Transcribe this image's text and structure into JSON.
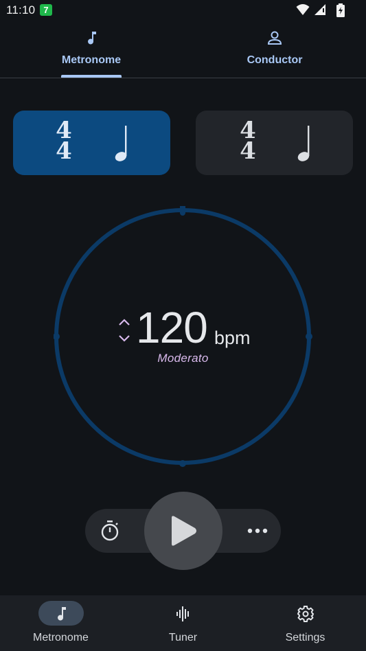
{
  "status_bar": {
    "time": "11:10",
    "notification_badge": "7",
    "icons": [
      "wifi-icon",
      "signal-icon",
      "battery-charging-icon"
    ]
  },
  "top_tabs": [
    {
      "label": "Metronome",
      "icon": "music-note-icon",
      "selected": true
    },
    {
      "label": "Conductor",
      "icon": "person-icon",
      "selected": false
    }
  ],
  "time_signatures": [
    {
      "numerator": "4",
      "denominator": "4",
      "note": "quarter-note-icon",
      "active": true
    },
    {
      "numerator": "4",
      "denominator": "4",
      "note": "quarter-note-icon",
      "active": false
    }
  ],
  "tempo": {
    "value": "120",
    "unit": "bpm",
    "name": "Moderato"
  },
  "transport": {
    "timer_icon": "stopwatch-icon",
    "play_icon": "play-icon",
    "more_icon": "more-horizontal-icon"
  },
  "bottom_nav": [
    {
      "label": "Metronome",
      "icon": "music-note-icon",
      "selected": true
    },
    {
      "label": "Tuner",
      "icon": "waveform-icon",
      "selected": false
    },
    {
      "label": "Settings",
      "icon": "gear-icon",
      "selected": false
    }
  ],
  "colors": {
    "background": "#111418",
    "accent": "#a9c8f5",
    "active_card": "#0c4a80",
    "dial_ring": "#0b3a66",
    "tempo_name": "#d8b9ec"
  }
}
